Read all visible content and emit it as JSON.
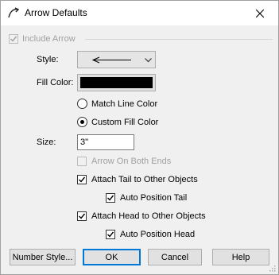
{
  "window": {
    "title": "Arrow Defaults"
  },
  "include_arrow": {
    "label": "Include Arrow",
    "checked": true,
    "enabled": false
  },
  "style": {
    "label": "Style:"
  },
  "fill_color": {
    "label": "Fill Color:",
    "value": "#000000"
  },
  "fill_mode": {
    "options": [
      "Match Line Color",
      "Custom Fill Color"
    ],
    "selected": "Custom Fill Color"
  },
  "size": {
    "label": "Size:",
    "value": "3\""
  },
  "arrow_on_both_ends": {
    "label": "Arrow On Both Ends",
    "checked": false,
    "enabled": false
  },
  "attach_tail": {
    "label": "Attach Tail to Other Objects",
    "checked": true
  },
  "auto_position_tail": {
    "label": "Auto Position Tail",
    "checked": true
  },
  "attach_head": {
    "label": "Attach Head to Other Objects",
    "checked": true
  },
  "auto_position_head": {
    "label": "Auto Position Head",
    "checked": true
  },
  "buttons": {
    "number_style": "Number Style...",
    "ok": "OK",
    "cancel": "Cancel",
    "help": "Help"
  },
  "colors": {
    "accent": "#0078d7",
    "dialog_bg": "#f0f0f0",
    "disabled_text": "#a0a0a0"
  }
}
